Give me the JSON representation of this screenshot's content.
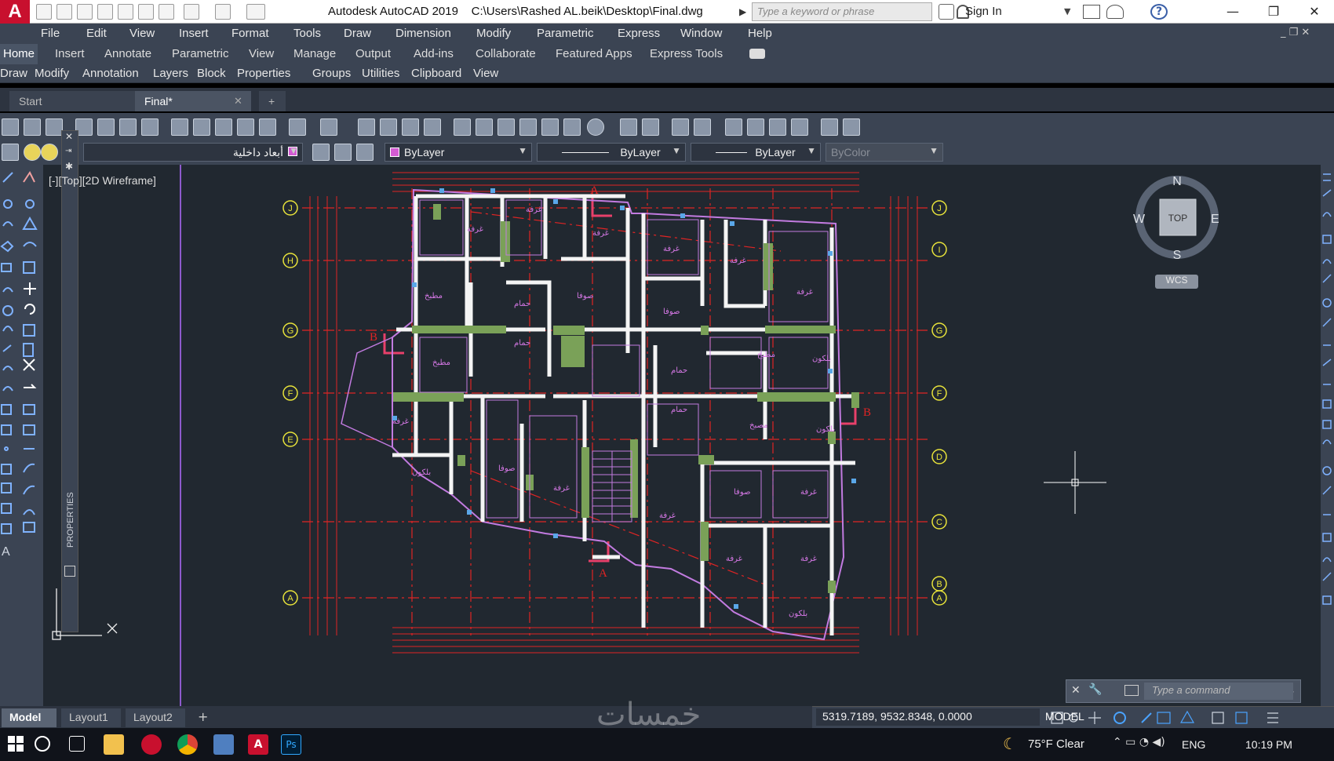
{
  "titlebar": {
    "logo": "A",
    "title": "Autodesk AutoCAD 2019    C:\\Users\\Rashed AL.beik\\Desktop\\Final.dwg",
    "search_placeholder": "Type a keyword or phrase",
    "sign_in": "Sign In",
    "help": "?"
  },
  "menubar": [
    "File",
    "Edit",
    "View",
    "Insert",
    "Format",
    "Tools",
    "Draw",
    "Dimension",
    "Modify",
    "Parametric",
    "Express",
    "Window",
    "Help"
  ],
  "ribbon_tabs": [
    "Home",
    "Insert",
    "Annotate",
    "Parametric",
    "View",
    "Manage",
    "Output",
    "Add-ins",
    "Collaborate",
    "Featured Apps",
    "Express Tools"
  ],
  "ribbon_panels": [
    "Draw",
    "Modify",
    "Annotation",
    "Layers",
    "Block",
    "Properties",
    "Groups",
    "Utilities",
    "Clipboard",
    "View"
  ],
  "doc_tabs": {
    "start": "Start",
    "active": "Final*",
    "add": "+"
  },
  "toolbar2": {
    "layer_name": "أبعاد داخلية",
    "color": "ByLayer",
    "linetype": "ByLayer",
    "lineweight": "ByLayer",
    "plotstyle": "ByColor"
  },
  "viewport_label": "[-][Top][2D Wireframe]",
  "palette_label": "PROPERTIES",
  "viewcube": {
    "n": "N",
    "s": "S",
    "e": "E",
    "w": "W",
    "face": "TOP",
    "ucs": "WCS"
  },
  "grid_labels_left": [
    "J",
    "H",
    "G",
    "F",
    "E",
    "A"
  ],
  "grid_labels_right": [
    "J",
    "I",
    "G",
    "F",
    "D",
    "C",
    "B",
    "A"
  ],
  "section_marks": [
    "A",
    "A",
    "B",
    "B"
  ],
  "command_line": {
    "placeholder": "Type a command"
  },
  "layout_tabs": [
    "Model",
    "Layout1",
    "Layout2"
  ],
  "status": {
    "coords": "5319.7189, 9532.8348, 0.0000",
    "mode": "MODEL"
  },
  "taskbar": {
    "weather": "75°F  Clear",
    "lang": "ENG",
    "time": "10:19 PM"
  },
  "watermark": "خمسات"
}
